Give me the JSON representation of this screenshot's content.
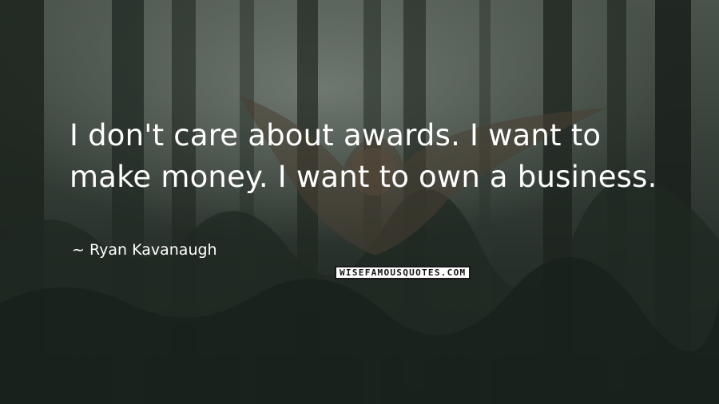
{
  "quote": {
    "text": "I don't care about awards. I want to make money. I want to own a business."
  },
  "author": {
    "prefix": "~",
    "name": "Ryan Kavanaugh"
  },
  "watermark": {
    "text": "WISEFAMOUSQUOTES.COM"
  },
  "background": {
    "subject": "owl flying through a dark forest",
    "colors": {
      "sky": "#8a948b",
      "forest": "#27302a",
      "text": "#ffffff"
    }
  }
}
